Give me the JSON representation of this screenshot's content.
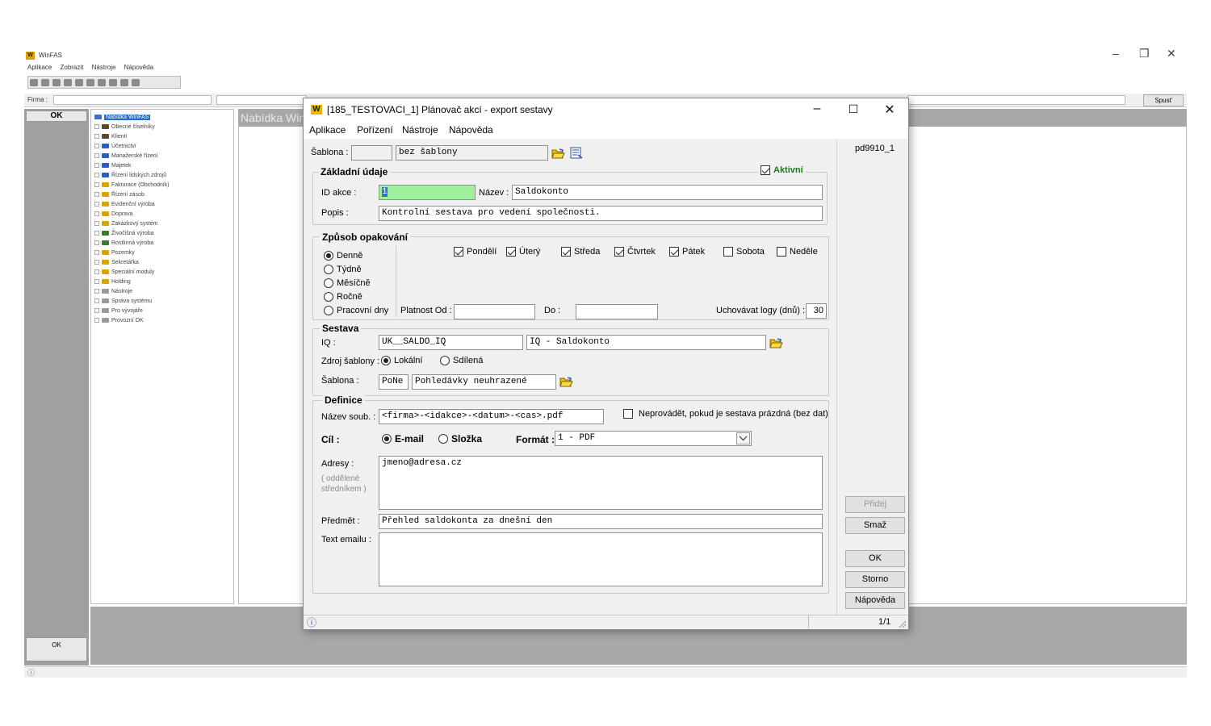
{
  "app": {
    "title": "WinFAS",
    "menu": [
      "Aplikace",
      "Zobrazit",
      "Nástroje",
      "Nápověda"
    ],
    "firma_label": "Firma :",
    "spust_label": "Spusť",
    "ok_label": "OK",
    "panel_header": "Nabídka WinFAS",
    "tree": {
      "root": "Nabídka WinFAS",
      "items": [
        {
          "label": "Obecné číselníky",
          "color": "#5a4a2a"
        },
        {
          "label": "Klienti",
          "color": "#5a4a2a"
        },
        {
          "label": "Účetnictví",
          "color": "#2a5fbf"
        },
        {
          "label": "Manažerské řízení",
          "color": "#2a5fbf"
        },
        {
          "label": "Majetek",
          "color": "#2a5fbf"
        },
        {
          "label": "Řízení lidských zdrojů",
          "color": "#2a5fbf"
        },
        {
          "label": "Fakturace (Obchodník)",
          "color": "#d9a400"
        },
        {
          "label": "Řízení zásob",
          "color": "#d9a400"
        },
        {
          "label": "Evidenční výroba",
          "color": "#d9a400"
        },
        {
          "label": "Doprava",
          "color": "#d9a400"
        },
        {
          "label": "Zakázkový systém",
          "color": "#d9a400"
        },
        {
          "label": "Živočišná výroba",
          "color": "#3a7a2a"
        },
        {
          "label": "Rostlinná výroba",
          "color": "#3a7a2a"
        },
        {
          "label": "Pozemky",
          "color": "#d9a400"
        },
        {
          "label": "Sekretářka",
          "color": "#d9a400"
        },
        {
          "label": "Speciální moduly",
          "color": "#d9a400"
        },
        {
          "label": "Holding",
          "color": "#d9a400"
        },
        {
          "label": "Nástroje",
          "color": "#9a9a9a"
        },
        {
          "label": "Správa systému",
          "color": "#9a9a9a"
        },
        {
          "label": "Pro vývojáře",
          "color": "#9a9a9a"
        },
        {
          "label": "Provozní OK",
          "color": "#9a9a9a"
        }
      ]
    }
  },
  "dialog": {
    "title": "[185_TESTOVACI_1] Plánovač akcí - export sestavy",
    "menu": [
      "Aplikace",
      "Pořízení",
      "Nástroje",
      "Nápověda"
    ],
    "form_id": "pd9910_1",
    "sablona": {
      "label": "Šablona :",
      "code": "",
      "value": "bez šablony"
    },
    "zakladni": {
      "title": "Základní údaje",
      "aktivni_label": "Aktivní",
      "aktivni_checked": true,
      "id_label": "ID akce :",
      "id_value": "1",
      "nazev_label": "Název :",
      "nazev_value": "Saldokonto",
      "popis_label": "Popis :",
      "popis_value": "Kontrolní sestava pro vedení společnosti."
    },
    "opakovani": {
      "title": "Způsob opakování",
      "modes": [
        {
          "label": "Denně",
          "selected": true
        },
        {
          "label": "Týdně",
          "selected": false
        },
        {
          "label": "Měsíčně",
          "selected": false
        },
        {
          "label": "Ročně",
          "selected": false
        },
        {
          "label": "Pracovní dny",
          "selected": false
        }
      ],
      "days": [
        {
          "label": "Pondělí",
          "checked": true
        },
        {
          "label": "Úterý",
          "checked": true
        },
        {
          "label": "Středa",
          "checked": true
        },
        {
          "label": "Čtvrtek",
          "checked": true
        },
        {
          "label": "Pátek",
          "checked": true
        },
        {
          "label": "Sobota",
          "checked": false
        },
        {
          "label": "Neděle",
          "checked": false
        }
      ],
      "platnost_od_label": "Platnost Od :",
      "platnost_od": "",
      "do_label": "Do :",
      "do": "",
      "logy_label": "Uchovávat logy (dnů) :",
      "logy_value": "30"
    },
    "sestava": {
      "title": "Sestava",
      "iq_label": "IQ :",
      "iq_code": "UK__SALDO_IQ",
      "iq_name": "IQ - Saldokonto",
      "zdroj_label": "Zdroj šablony :",
      "zdroj_options": [
        {
          "label": "Lokální",
          "selected": true
        },
        {
          "label": "Sdílená",
          "selected": false
        }
      ],
      "sablona_label": "Šablona :",
      "sablona_code": "PoNe",
      "sablona_name": "Pohledávky neuhrazené"
    },
    "definice": {
      "title": "Definice",
      "nazev_label": "Název soub. :",
      "nazev_value": "<firma>-<idakce>-<datum>-<cas>.pdf",
      "neprovadet_label": "Neprovádět, pokud je sestava prázdná (bez dat)",
      "neprovadet_checked": false,
      "cil_label": "Cíl :",
      "cil_options": [
        {
          "label": "E-mail",
          "selected": true
        },
        {
          "label": "Složka",
          "selected": false
        }
      ],
      "format_label": "Formát :",
      "format_value": "1 - PDF",
      "adresy_label": "Adresy :",
      "adresy_hint1": "( oddělené",
      "adresy_hint2": "středníkem )",
      "adresy_value": "jmeno@adresa.cz",
      "predmet_label": "Předmět :",
      "predmet_value": "Přehled saldokonta za dnešní den",
      "text_label": "Text emailu :",
      "text_value": ""
    },
    "buttons": {
      "pridej": "Přidej",
      "smaz": "Smaž",
      "ok": "OK",
      "storno": "Storno",
      "napoveda": "Nápověda"
    },
    "status": {
      "pager": "1/1"
    }
  }
}
